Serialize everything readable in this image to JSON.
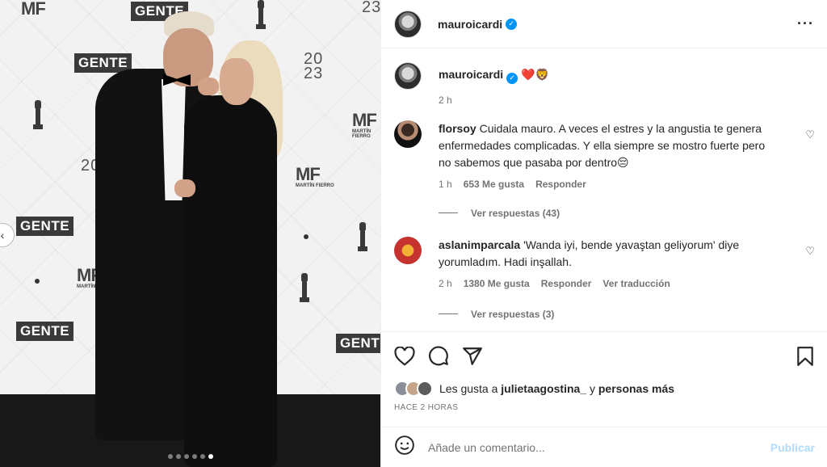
{
  "photo": {
    "backdrop_logos": {
      "gente": "GENTE",
      "mf": "MF",
      "mf_sub": "MARTÍN FIERRO",
      "year_top": "20",
      "year_bottom": "23"
    },
    "carousel": {
      "total": 6,
      "active": 6
    }
  },
  "header": {
    "username": "mauroicardi",
    "verified": true
  },
  "caption": {
    "username": "mauroicardi",
    "text": "❤️🦁",
    "time": "2 h"
  },
  "comments": [
    {
      "username": "florsoy",
      "text": "Cuidala mauro. A veces el estres y la angustia te genera enfermedades complicadas. Y ella siempre se mostro fuerte pero no sabemos que pasaba por dentro😔",
      "time": "1 h",
      "likes": "653 Me gusta",
      "reply": "Responder",
      "view_replies": "Ver respuestas (43)"
    },
    {
      "username": "aslanimparcala",
      "text": "'Wanda iyi, bende yavaştan geliyorum' diye yorumladım. Hadi inşallah.",
      "time": "2 h",
      "likes": "1380 Me gusta",
      "reply": "Responder",
      "translate": "Ver traducción",
      "view_replies": "Ver respuestas (3)"
    }
  ],
  "likes": {
    "prefix": "Les gusta a",
    "user": "julietaagostina_",
    "middle": "y",
    "suffix": "personas más"
  },
  "posted": "HACE 2 HORAS",
  "composer": {
    "placeholder": "Añade un comentario...",
    "post_label": "Publicar"
  },
  "icons": [
    "heart-icon",
    "comment-icon",
    "share-icon",
    "bookmark-icon",
    "emoji-icon",
    "more-icon",
    "verified-icon"
  ],
  "colors": {
    "verified": "#0095f6",
    "post_disabled": "#b3dbff",
    "muted": "#737373"
  }
}
